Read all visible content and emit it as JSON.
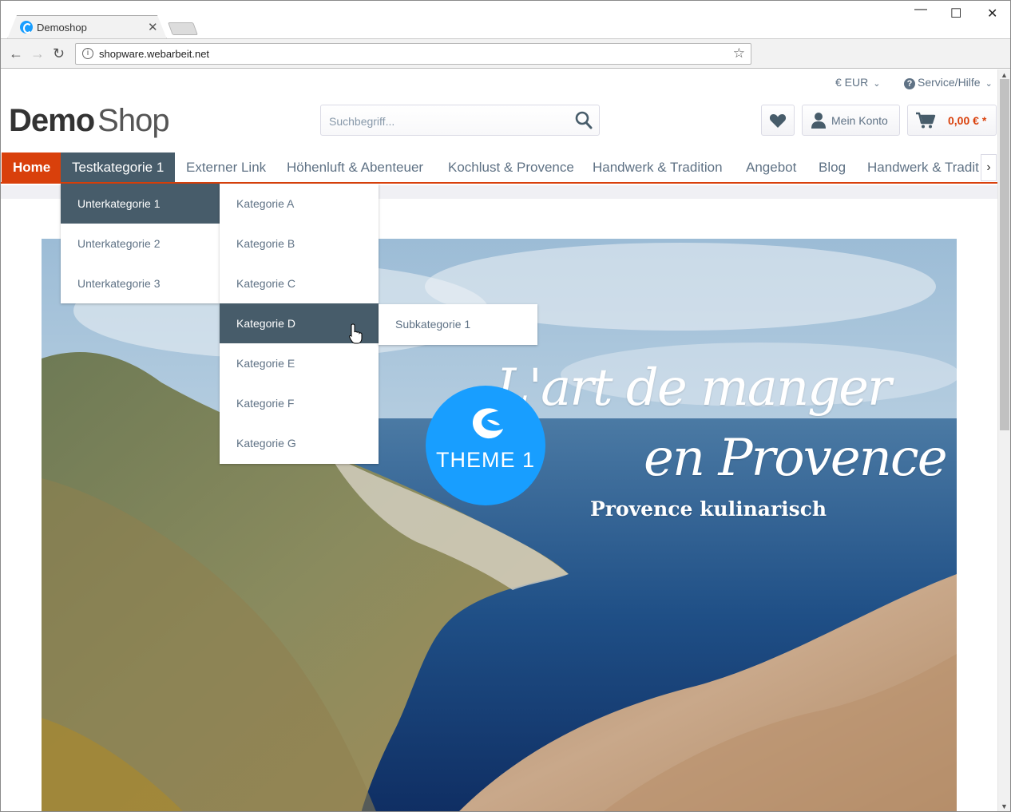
{
  "browser": {
    "tab_title": "Demoshop",
    "url": "shopware.webarbeit.net"
  },
  "topbar": {
    "currency": "€ EUR",
    "service": "Service/Hilfe"
  },
  "logo": {
    "bold": "Demo",
    "light": "Shop"
  },
  "search": {
    "placeholder": "Suchbegriff..."
  },
  "account": {
    "label": "Mein Konto"
  },
  "cart": {
    "amount": "0,00 € *"
  },
  "nav": {
    "items": [
      "Home",
      "Testkategorie 1",
      "Externer Link",
      "Höhenluft & Abenteuer",
      "Kochlust & Provence",
      "Handwerk & Tradition",
      "Angebot",
      "Blog",
      "Handwerk & Tradit"
    ]
  },
  "menu_level1": [
    "Unterkategorie 1",
    "Unterkategorie 2",
    "Unterkategorie 3"
  ],
  "menu_level2": [
    "Kategorie A",
    "Kategorie B",
    "Kategorie C",
    "Kategorie D",
    "Kategorie E",
    "Kategorie F",
    "Kategorie G"
  ],
  "menu_level3": [
    "Subkategorie 1"
  ],
  "hero": {
    "title_line1": "L'art de manger",
    "title_line2": "en Provence",
    "subtitle": "Provence kulinarisch",
    "badge": "THEME 1"
  },
  "colors": {
    "accent": "#d9400b",
    "menu_selected": "#475c6a",
    "badge": "#189eff",
    "text": "#5f7285"
  }
}
